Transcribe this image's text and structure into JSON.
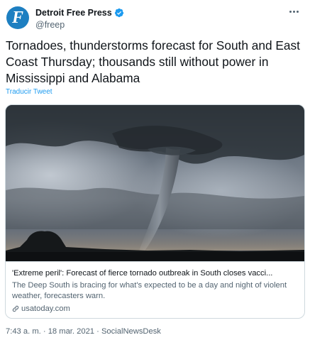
{
  "author": {
    "display_name": "Detroit Free Press",
    "handle": "@freep",
    "avatar_letter": "F",
    "verified": true
  },
  "tweet": {
    "text": "Tornadoes, thunderstorms forecast for South and East Coast Thursday; thousands still without power in Mississippi and Alabama",
    "translate_label": "Traducir Tweet"
  },
  "card": {
    "title": "'Extreme peril': Forecast of fierce tornado outbreak in South closes vacci...",
    "description": "The Deep South is bracing for what's expected to be a day and night of violent weather, forecasters warn.",
    "domain": "usatoday.com"
  },
  "meta": {
    "time": "7:43 a. m.",
    "separator": "·",
    "date": "18 mar. 2021",
    "source": "SocialNewsDesk"
  },
  "colors": {
    "accent": "#1d9bf0",
    "avatar_bg": "#1d7fc1",
    "secondary_text": "#536471",
    "border": "#cfd9de"
  },
  "icons": {
    "verified": "verified-badge-icon",
    "more": "more-horizontal-icon",
    "link": "link-icon"
  }
}
